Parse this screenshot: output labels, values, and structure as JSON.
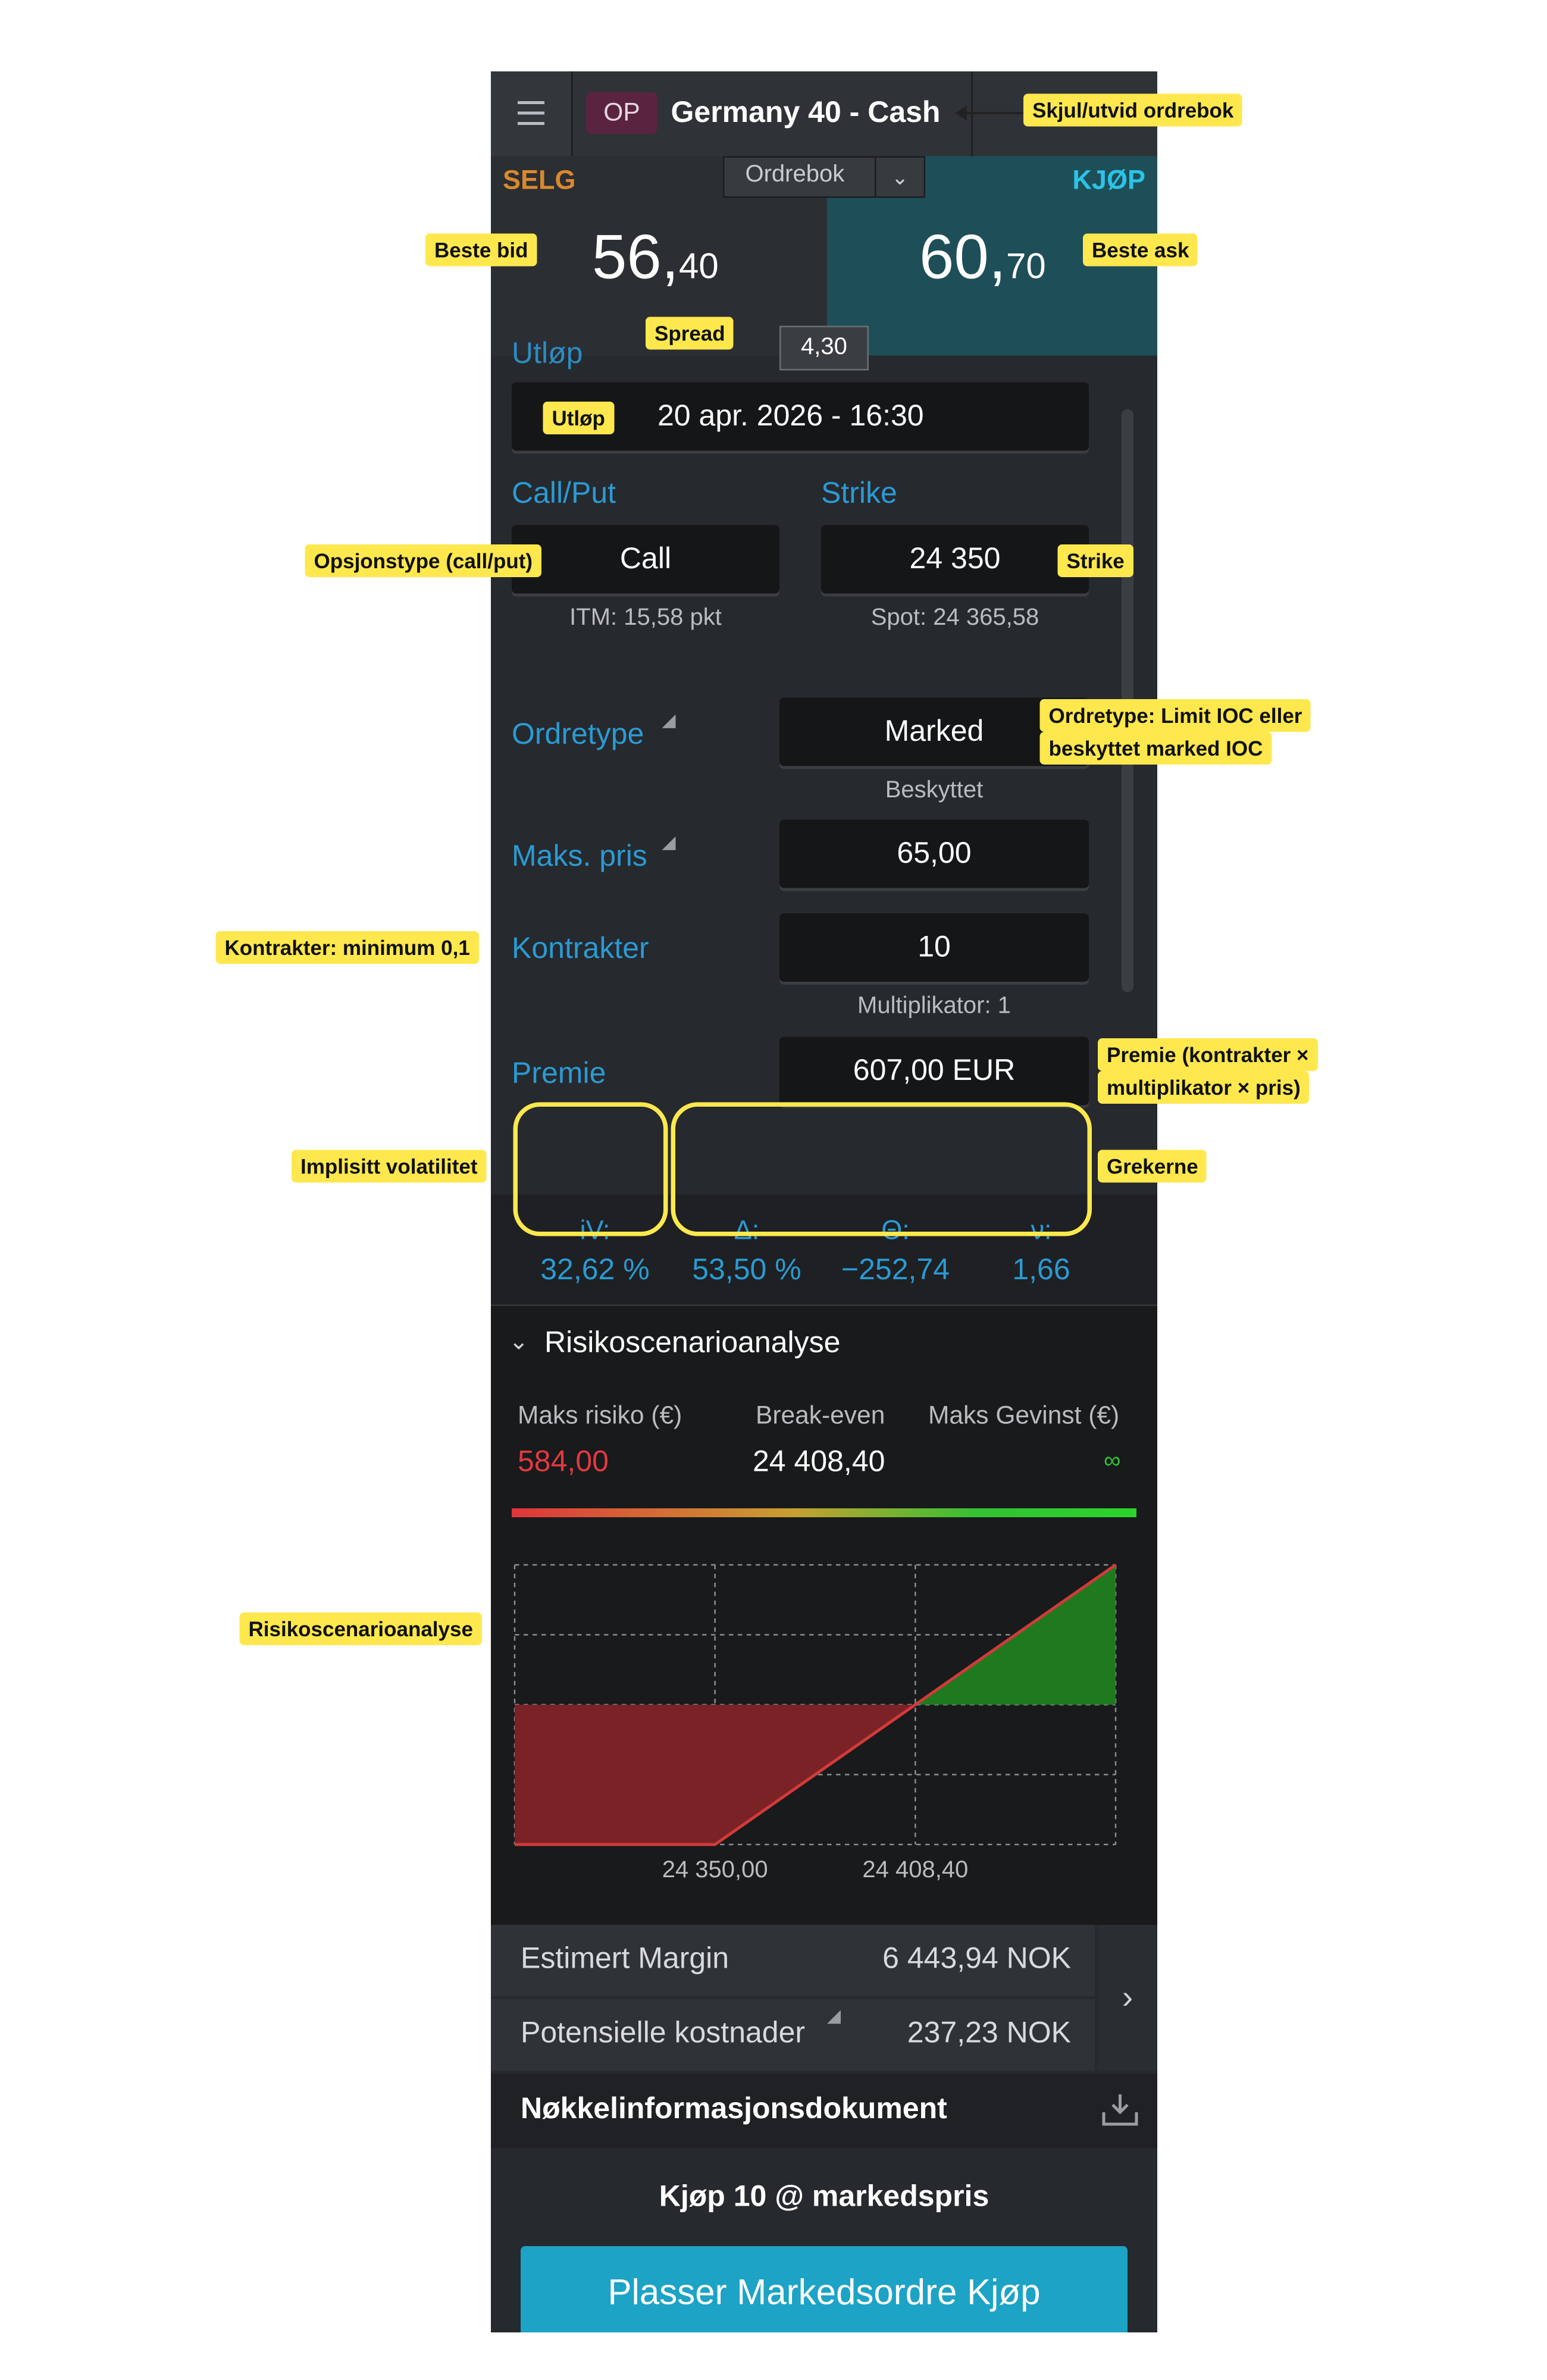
{
  "header": {
    "badge": "OP",
    "instrument": "Germany 40 - Cash"
  },
  "orderbook": {
    "sell_label": "SELG",
    "buy_label": "KJØP",
    "selector": "Ordrebok",
    "bid_int": "56,",
    "bid_dec": "40",
    "ask_int": "60,",
    "ask_dec": "70",
    "spread": "4,30"
  },
  "form": {
    "expiry_cut_label": "Utløp",
    "expiry_value": "20 apr. 2026 - 16:30",
    "callput_label": "Call/Put",
    "callput_value": "Call",
    "itm": "ITM: 15,58 pkt",
    "strike_label": "Strike",
    "strike_value": "24 350",
    "spot": "Spot: 24 365,58",
    "ordertype_label": "Ordretype",
    "ordertype_value": "Marked",
    "ordertype_sub": "Beskyttet",
    "maxprice_label": "Maks. pris",
    "maxprice_value": "65,00",
    "contracts_label": "Kontrakter",
    "contracts_value": "10",
    "multiplier": "Multiplikator: 1",
    "premium_label": "Premie",
    "premium_value": "607,00 EUR"
  },
  "greeks": {
    "iv_label": "iV:",
    "iv_value": "32,62 %",
    "delta_label": "Δ:",
    "delta_value": "53,50 %",
    "theta_label": "Θ:",
    "theta_value": "−252,74",
    "vega_label": "ν:",
    "vega_value": "1,66"
  },
  "risk": {
    "title": "Risikoscenarioanalyse",
    "max_risk_label": "Maks risiko (€)",
    "max_risk_value": "584,00",
    "breakeven_label": "Break-even",
    "breakeven_value": "24 408,40",
    "max_gain_label": "Maks Gevinst (€)",
    "max_gain_value": "∞"
  },
  "chart_data": {
    "type": "area",
    "title": "",
    "xlabel": "",
    "ylabel": "",
    "tick_labels": [
      "24 350,00",
      "24 408,40"
    ],
    "x": [
      24291.6,
      24350.0,
      24408.4,
      24466.8
    ],
    "y": [
      -584,
      -584,
      0,
      584
    ],
    "fill_negative": "#7a2226",
    "fill_positive": "#1f7a1f",
    "grid": true
  },
  "bottom": {
    "margin_label": "Estimert Margin",
    "margin_value": "6 443,94 NOK",
    "costs_label": "Potensielle kostnader",
    "costs_value": "237,23 NOK",
    "kid_label": "Nøkkelinformasjonsdokument",
    "summary": "Kjøp 10 @ markedspris",
    "cta": "Plasser Markedsordre Kjøp"
  },
  "annotations": {
    "toggle_orderbook": "Skjul/utvid ordrebok",
    "best_bid": "Beste bid",
    "best_ask": "Beste ask",
    "spread": "Spread",
    "expiry": "Utløp",
    "option_type": "Opsjonstype (call/put)",
    "strike": "Strike",
    "ordertype_1": "Ordretype: Limit IOC eller",
    "ordertype_2": "beskyttet marked IOC",
    "contracts": "Kontrakter: minimum 0,1",
    "premium_1": "Premie (kontrakter ×",
    "premium_2": "multiplikator × pris)",
    "iv": "Implisitt volatilitet",
    "greeks": "Grekerne",
    "risk": "Risikoscenarioanalyse"
  }
}
